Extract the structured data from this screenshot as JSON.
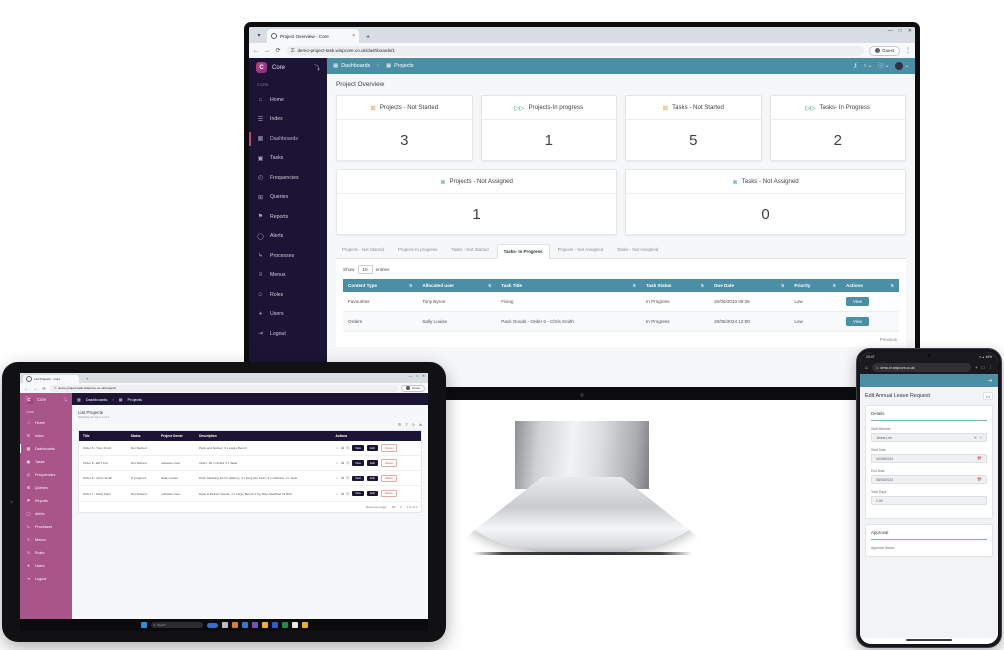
{
  "desktop": {
    "browser": {
      "tab_title": "Project Overview - Core",
      "tab_close": "×",
      "new_tab": "+",
      "caret": "▾",
      "back": "←",
      "forward": "→",
      "reload": "⟳",
      "lock_icon": "lock-icon",
      "url": "demo-project-task.wispcore.co.uk/dashboards/1",
      "profile_label": "Guest",
      "kebab": "⋮",
      "win_minimize": "—",
      "win_maximize": "□",
      "win_close": "✕"
    },
    "sidebar": {
      "brand": "Core",
      "logo_letter": "C",
      "pin_icon": "⤵",
      "section_label": "CORE",
      "items": [
        {
          "label": "Home",
          "icon": "⌂"
        },
        {
          "label": "Index",
          "icon": "☰"
        },
        {
          "label": "Dashboards",
          "icon": "▦"
        },
        {
          "label": "Tasks",
          "icon": "▣"
        },
        {
          "label": "Frequencies",
          "icon": "◴"
        },
        {
          "label": "Queries",
          "icon": "⊞"
        },
        {
          "label": "Reports",
          "icon": "⚑"
        },
        {
          "label": "Alerts",
          "icon": "◯"
        },
        {
          "label": "Processes",
          "icon": "↳"
        },
        {
          "label": "Menus",
          "icon": "≡"
        },
        {
          "label": "Roles",
          "icon": "☺"
        },
        {
          "label": "Users",
          "icon": "⚹"
        },
        {
          "label": "Logout",
          "icon": "⇥"
        }
      ],
      "active_index": 2
    },
    "appbar": {
      "crumb1": "Dashboards",
      "crumb1_icon": "▦",
      "separator": "›",
      "crumb2": "Projects",
      "crumb2_icon": "▦",
      "icon_key": "⚷",
      "icon_bell": "○",
      "icon_help": "ⓘ",
      "chevron": "⌄"
    },
    "page_title": "Project Overview",
    "kpis_row1": [
      {
        "label": "Projects - Not Started",
        "value": "3",
        "icon": "⊠",
        "icon_kind": "warn"
      },
      {
        "label": "Projects-In progress",
        "value": "1",
        "icon": "▷▷",
        "icon_kind": "prog"
      },
      {
        "label": "Tasks - Not Started",
        "value": "5",
        "icon": "⊠",
        "icon_kind": "warn"
      },
      {
        "label": "Tasks- In Progress",
        "value": "2",
        "icon": "▷▷",
        "icon_kind": "prog"
      }
    ],
    "kpis_row2": [
      {
        "label": "Projects - Not Assigned",
        "value": "1",
        "icon": "⊗",
        "icon_kind": "bell"
      },
      {
        "label": "Tasks - Not Assigned",
        "value": "0",
        "icon": "⊗",
        "icon_kind": "bell"
      }
    ],
    "tabs": [
      "Projects - Not Started",
      "Projects-In progress",
      "Tasks - Not Started",
      "Tasks- In Progress",
      "Projects - Not Assigned",
      "Tasks - Not Assigned"
    ],
    "active_tab_index": 3,
    "table": {
      "show_prefix": "Show",
      "show_value": "10",
      "show_suffix": "entries",
      "sort_icon": "⇅",
      "columns": [
        "Content Type",
        "Allocated user",
        "Task Title",
        "Task Status",
        "Due Date",
        "Priority",
        "Actions"
      ],
      "rows": [
        {
          "content_type": "Favourites",
          "allocated_user": "Tony Byron",
          "task_title": "Fixing",
          "task_status": "In Progress",
          "due_date": "20/06/2010 08:25",
          "priority": "Low",
          "action": "View"
        },
        {
          "content_type": "Orders",
          "allocated_user": "Sally Louise",
          "task_title": "Pack Goods - Order 6 - Chris Smith",
          "task_status": "In Progress",
          "due_date": "20/05/2024 12:00",
          "priority": "Low",
          "action": "View"
        }
      ],
      "pager_prev": "Previous"
    }
  },
  "tablet": {
    "browser": {
      "tab_title": "List Projects - Core",
      "new_tab": "+",
      "url": "demo-project-task.wispcore.co.uk/projects",
      "profile_label": "Guest",
      "win_minimize": "—",
      "win_maximize": "□",
      "win_close": "✕"
    },
    "sidebar": {
      "brand": "Core",
      "logo_letter": "C",
      "pin_icon": "⤵",
      "section_label": "CORE",
      "items": [
        {
          "label": "Home",
          "icon": "⌂"
        },
        {
          "label": "Index",
          "icon": "☰"
        },
        {
          "label": "Dashboards",
          "icon": "▦"
        },
        {
          "label": "Tasks",
          "icon": "▣"
        },
        {
          "label": "Frequencies",
          "icon": "◴"
        },
        {
          "label": "Queries",
          "icon": "⊞"
        },
        {
          "label": "Reports",
          "icon": "⚑"
        },
        {
          "label": "Alerts",
          "icon": "◯"
        },
        {
          "label": "Processes",
          "icon": "↳"
        },
        {
          "label": "Menus",
          "icon": "≡"
        },
        {
          "label": "Roles",
          "icon": "☺"
        },
        {
          "label": "Users",
          "icon": "⚹"
        },
        {
          "label": "Logout",
          "icon": "⇥"
        }
      ],
      "active_index": 2
    },
    "appbar": {
      "crumb1": "Dashboards",
      "separator": "›",
      "crumb2": "Projects",
      "icon": "▦"
    },
    "page_title": "List Projects",
    "page_subtitle": "Showing items 1-4 of 4",
    "toolbar_icons": [
      "☰",
      "▽",
      "↻",
      "⊕"
    ],
    "table": {
      "columns": [
        "Title",
        "Status",
        "Project Owner",
        "Description",
        "Actions"
      ],
      "rows": [
        {
          "title": "Order 8 - Tony Fredz",
          "status": "Not Started",
          "owner": "",
          "description": "Pack and Deliver, 3 x Large Bench",
          "star": "☆",
          "copy": "⧉",
          "note": "⎘",
          "view": "View",
          "edit": "Edit",
          "delete": "Delete"
        },
        {
          "title": "Order 8 - EFT List",
          "status": "Not Started",
          "owner": "software User",
          "description": "Order, 18 x Chairs 3 x Table",
          "star": "☆",
          "copy": "⧉",
          "note": "⎘",
          "view": "View",
          "edit": "Edit",
          "delete": "Delete"
        },
        {
          "title": "Order 6 - Chris Smith",
          "status": "In progress",
          "owner": "Sally Louise",
          "description": "Pack following list for delivery, 3 x long size beds, 3 x cabinets, 2 x beds",
          "star": "☆",
          "copy": "⧉",
          "note": "⎘",
          "view": "View",
          "edit": "Edit",
          "delete": "Delete"
        },
        {
          "title": "Order 7 - Dolly Farm",
          "status": "Not Started",
          "owner": "software User",
          "description": "Pack & Deliver Goods, 4 x Large Bench 1 Kg Rust Shelfbed 31 B02",
          "star": "☆",
          "copy": "⧉",
          "note": "⎘",
          "view": "View",
          "edit": "Edit",
          "delete": "Delete"
        }
      ],
      "rows_per_page_label": "Rows per page:",
      "rows_per_page_value": "50",
      "range_label": "1-4 of 4"
    },
    "taskbar": {
      "search_placeholder": "Search"
    }
  },
  "phone": {
    "status": {
      "time": "10:47",
      "battery": "44%",
      "wifi_icon": "▾",
      "signal_icon": "▲"
    },
    "browser": {
      "home_icon": "⌂",
      "lock_icon": "⚿",
      "url": "demo-hr.wispcore.co.uk/",
      "new_tab": "+",
      "tabs_icon": "□",
      "kebab": "⋮"
    },
    "appbar_icon": "⇥",
    "page_title": "Edit Annual Leave Request",
    "kebab_label": "•••",
    "details_section": "Details",
    "fields": [
      {
        "label": "Staff Member",
        "value": "Jenna Lee",
        "icon1": "✕",
        "icon2": "+"
      },
      {
        "label": "Start Date",
        "value": "02/05/2024",
        "icon1": "Ὄ5",
        "icon2": ""
      },
      {
        "label": "End Date",
        "value": "08/05/2024",
        "icon1": "Ὄ5",
        "icon2": ""
      },
      {
        "label": "Total Days",
        "value": "2.00",
        "icon1": "",
        "icon2": ""
      }
    ],
    "approval_section": "Approval",
    "approval_field_label": "Approval Status"
  },
  "taskbar": {
    "search_placeholder": "Search"
  }
}
